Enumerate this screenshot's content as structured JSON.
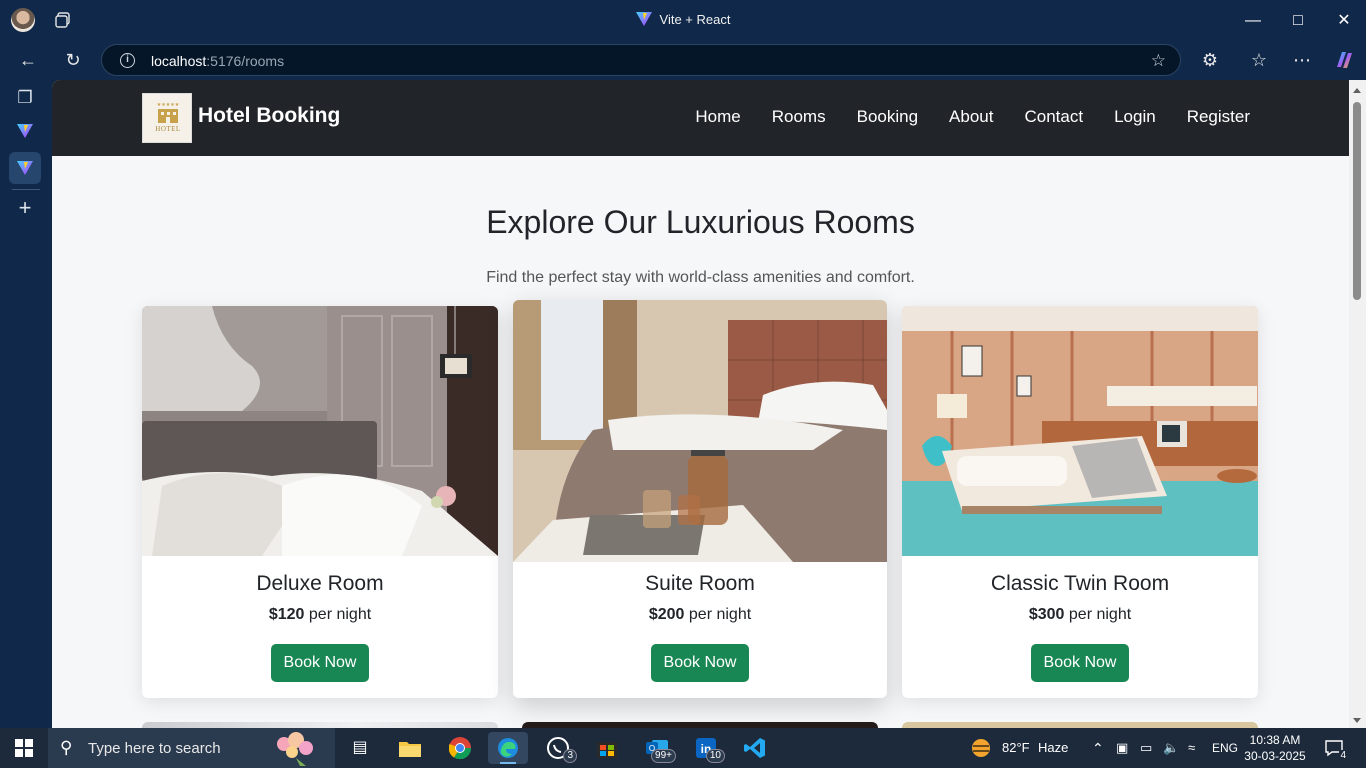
{
  "browser": {
    "tab_title": "Vite + React",
    "url_host": "localhost",
    "url_path": ":5176/rooms"
  },
  "site": {
    "logo_text": "HOTEL",
    "brand": "Hotel Booking",
    "nav": [
      "Home",
      "Rooms",
      "Booking",
      "About",
      "Contact",
      "Login",
      "Register"
    ],
    "heading": "Explore Our Luxurious Rooms",
    "subheading": "Find the perfect stay with world-class amenities and comfort."
  },
  "rooms": [
    {
      "name": "Deluxe Room",
      "price": "$120",
      "per": "per night",
      "button": "Book Now"
    },
    {
      "name": "Suite Room",
      "price": "$200",
      "per": "per night",
      "button": "Book Now"
    },
    {
      "name": "Classic Twin Room",
      "price": "$300",
      "per": "per night",
      "button": "Book Now"
    }
  ],
  "taskbar": {
    "search_placeholder": "Type here to search",
    "whatsapp_badge": "3",
    "outlook_badge": "99+",
    "linkedin_badge": "10",
    "weather_temp": "82°F",
    "weather_desc": "Haze",
    "lang": "ENG",
    "time": "10:38 AM",
    "date": "30-03-2025",
    "notification_count": "4"
  }
}
